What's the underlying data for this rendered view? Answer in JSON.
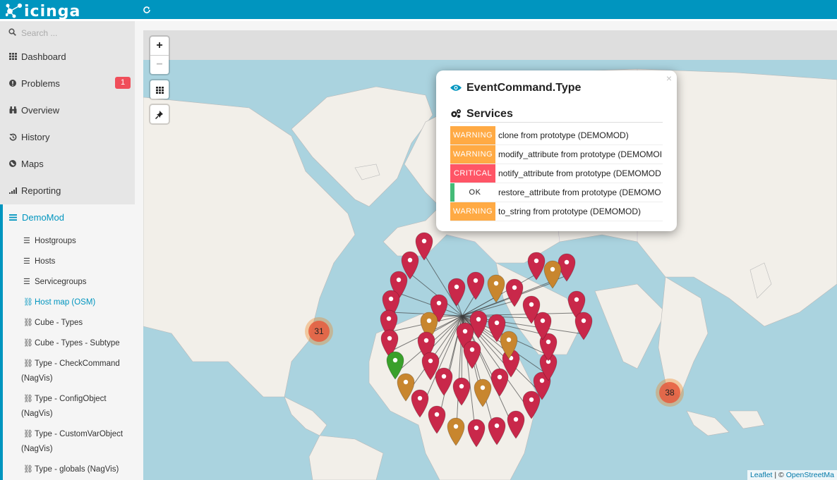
{
  "app": {
    "logo_text": "icinga"
  },
  "search": {
    "placeholder": "Search ..."
  },
  "nav": [
    {
      "label": "Dashboard"
    },
    {
      "label": "Problems",
      "badge": "1"
    },
    {
      "label": "Overview"
    },
    {
      "label": "History"
    },
    {
      "label": "Maps"
    },
    {
      "label": "Reporting"
    }
  ],
  "section": {
    "label": "DemoMod",
    "items": [
      {
        "label": "Hostgroups"
      },
      {
        "label": "Hosts"
      },
      {
        "label": "Servicegroups"
      },
      {
        "label": "Host map (OSM)"
      },
      {
        "label": "Cube - Types"
      },
      {
        "label": "Cube - Types - Subtype"
      },
      {
        "label": "Type - CheckCommand",
        "label2": "(NagVis)"
      },
      {
        "label": "Type - ConfigObject",
        "label2": "(NagVis)"
      },
      {
        "label": "Type - CustomVarObject",
        "label2": "(NagVis)"
      },
      {
        "label": "Type - globals (NagVis)"
      }
    ]
  },
  "map": {
    "zoom_in": "+",
    "zoom_out": "−",
    "clusters": [
      {
        "count": "31"
      },
      {
        "count": "38"
      }
    ],
    "attribution": {
      "leaflet": "Leaflet",
      "sep": " | © ",
      "osm": "OpenStreetMa"
    }
  },
  "popup": {
    "host": "EventCommand.Type",
    "services_heading": "Services",
    "services": [
      {
        "state": "WARNING",
        "name": "clone from prototype (DEMOMOD)"
      },
      {
        "state": "WARNING",
        "name": "modify_attribute from prototype (DEMOMOI"
      },
      {
        "state": "CRITICAL",
        "name": "notify_attribute from prototype (DEMOMOD"
      },
      {
        "state": "OK",
        "name": "restore_attribute from prototype (DEMOMO"
      },
      {
        "state": "WARNING",
        "name": "to_string from prototype (DEMOMOD)"
      }
    ],
    "close": "×"
  },
  "colors": {
    "brand": "#0095bf",
    "warning": "#ffaa44",
    "critical": "#ff5566",
    "ok": "#44bb77",
    "marker_critical": "#c9284a",
    "marker_warning": "#c8862e",
    "marker_ok": "#3aa02b"
  }
}
